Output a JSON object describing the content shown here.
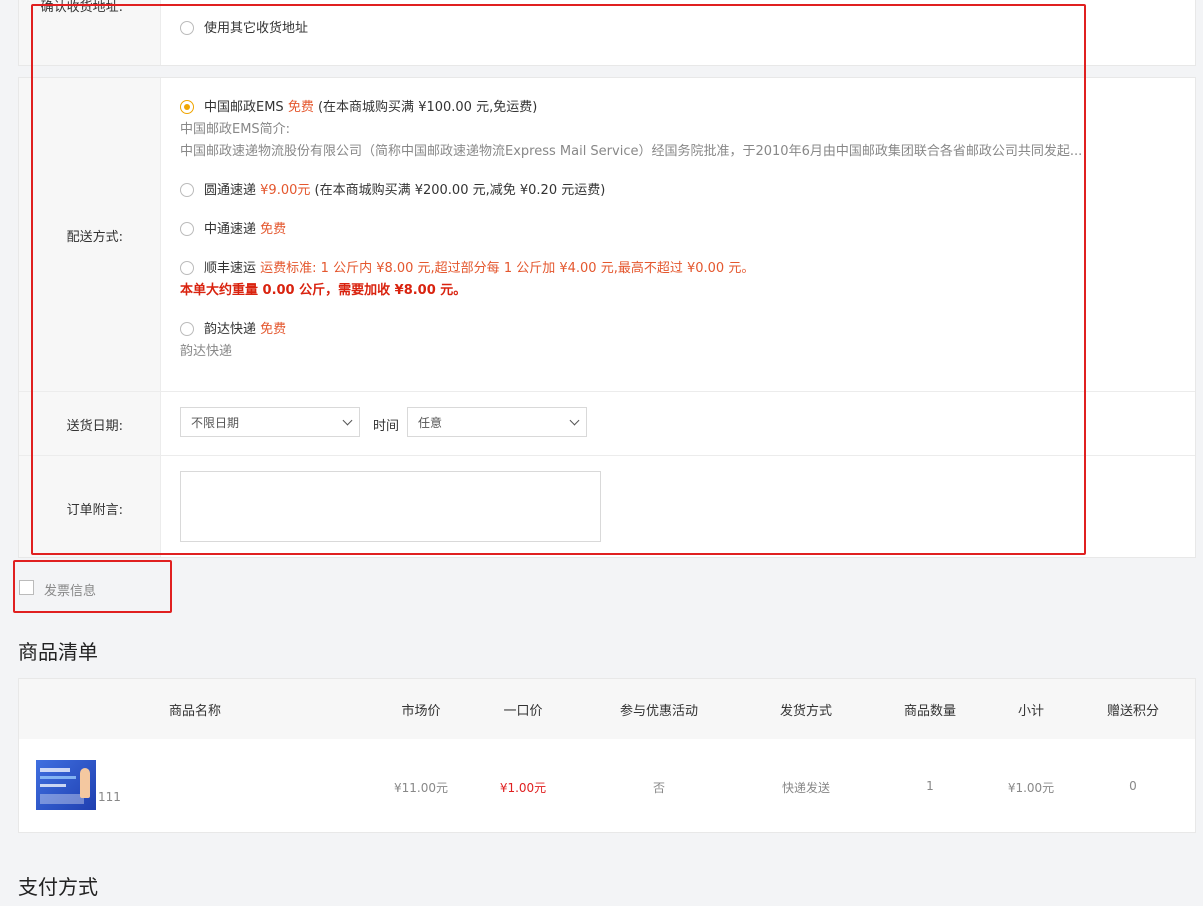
{
  "address": {
    "label": "确认收货地址:",
    "other_option": "使用其它收货地址"
  },
  "shipping": {
    "label": "配送方式:",
    "options": [
      {
        "name": "中国邮政EMS",
        "price": "免费",
        "note": "(在本商城购买满 ¥100.00 元,免运费)",
        "checked": true
      },
      {
        "name": "圆通速递",
        "price": "¥9.00元",
        "note": "(在本商城购买满 ¥200.00 元,减免 ¥0.20 元运费)",
        "checked": false
      },
      {
        "name": "中通速递",
        "price": "免费",
        "note": "",
        "checked": false
      },
      {
        "name": "顺丰速运",
        "price": "运费标准: 1 公斤内 ¥8.00 元,超过部分每 1 公斤加 ¥4.00 元,最高不超过 ¥0.00 元。",
        "note": "",
        "checked": false
      },
      {
        "name": "韵达快递",
        "price": "免费",
        "note": "",
        "checked": false
      }
    ],
    "ems_intro_title": "中国邮政EMS简介:",
    "ems_intro_text": "中国邮政速递物流股份有限公司（简称中国邮政速递物流Express Mail Service）经国务院批准，于2010年6月由中国邮政集团联合各省邮政公司共同发起...",
    "sf_weight_note": "本单大约重量 0.00 公斤，需要加收 ¥8.00 元。",
    "yunda_desc": "韵达快递"
  },
  "delivery_date": {
    "label": "送货日期:",
    "date_value": "不限日期",
    "time_label": "时间",
    "time_value": "任意"
  },
  "remark": {
    "label": "订单附言:",
    "value": ""
  },
  "invoice": {
    "label": "发票信息",
    "checked": false
  },
  "products": {
    "title": "商品清单",
    "headers": [
      "商品名称",
      "市场价",
      "一口价",
      "参与优惠活动",
      "发货方式",
      "商品数量",
      "小计",
      "赠送积分"
    ],
    "rows": [
      {
        "name": "111",
        "market_price": "¥11.00元",
        "price": "¥1.00元",
        "promotion": "否",
        "shipping": "快递发送",
        "qty": "1",
        "subtotal": "¥1.00元",
        "points": "0"
      }
    ]
  },
  "payment": {
    "title": "支付方式"
  },
  "colors": {
    "accent": "#f0a500",
    "price_red": "#e4572e",
    "highlight_red": "#e02020"
  }
}
